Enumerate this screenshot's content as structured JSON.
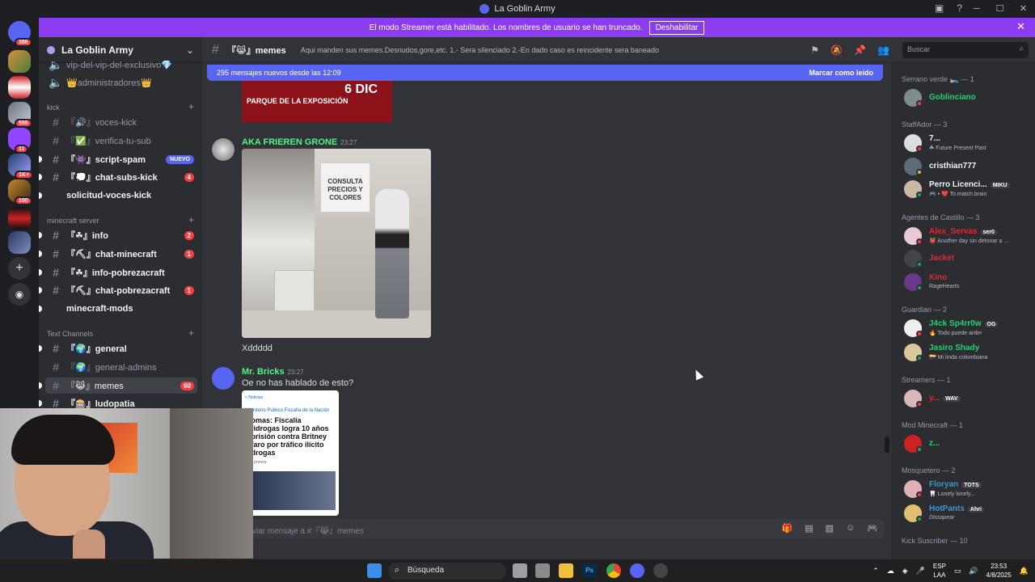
{
  "window": {
    "title": "La Goblin Army"
  },
  "banner": {
    "text": "El modo Streamer está habilitado. Los nombres de usuario se han truncado.",
    "button": "Deshabilitar"
  },
  "servers": [
    {
      "badge": "386"
    },
    {
      "badge": ""
    },
    {
      "badge": ""
    },
    {
      "badge": "555"
    },
    {
      "badge": "11"
    },
    {
      "badge": "1K+"
    },
    {
      "badge": "100"
    },
    {
      "badge": ""
    },
    {
      "badge": ""
    }
  ],
  "guild": {
    "name": "La Goblin Army"
  },
  "channels": {
    "top": [
      {
        "name": "vip-del-vip-del-exclusivo💎"
      },
      {
        "name": "👑administradores👑"
      }
    ],
    "cat_kick": "kick",
    "kick": [
      {
        "name": "『🔊』voces-kick"
      },
      {
        "name": "『✅』verifica-tu-sub"
      },
      {
        "name": "『👾』script-spam",
        "badge": "NUEVO"
      },
      {
        "name": "『💭』chat-subs-kick",
        "count": "4"
      },
      {
        "name": "solicitud-voces-kick"
      }
    ],
    "cat_minecraft": "minecraft server",
    "minecraft": [
      {
        "name": "『☘』info",
        "count": "2"
      },
      {
        "name": "『⛏』chat-minecraft",
        "count": "1"
      },
      {
        "name": "『☘』info-pobrezacraft"
      },
      {
        "name": "『⛏』chat-pobrezacraft",
        "count": "1"
      },
      {
        "name": "minecraft-mods"
      }
    ],
    "cat_text": "Text Channels",
    "text": [
      {
        "name": "『🌍』general"
      },
      {
        "name": "『🌍』general-admins"
      },
      {
        "name": "『😹』memes",
        "count": "60"
      },
      {
        "name": "『🎰』ludopatia"
      }
    ]
  },
  "header": {
    "channel": "『😹』memes",
    "topic": "Aqui manden sus memes.Desnudos,gore,etc. 1.- Sera silenciado 2.-En dado caso es reincidente sera baneado",
    "search_placeholder": "Buscar"
  },
  "new_messages": {
    "text": "295 mensajes nuevos desde las 12:09",
    "action": "Marcar como leído"
  },
  "messages": [
    {
      "image_text": "PARQUE DE LA EXPOSICIÓN",
      "image_big": "6 DIC"
    },
    {
      "author": "AKA FRIEREN GRONE",
      "time": "23:27",
      "image_sign": "CONSULTA PRECIOS Y COLORES",
      "text": "Xddddd"
    },
    {
      "author": "Mr. Bricks",
      "time": "23:27",
      "text": "Oe no has hablado de esto?",
      "news": {
        "src": "< Noticias",
        "org": "Ministerio Público Fiscalía de la Nación",
        "headline": "...omas: Fiscalía ...tidrogas logra 10 años ...prisión contra Britney ...faro por tráfico ilícito ...drogas",
        "note": "...de prensa"
      }
    }
  ],
  "composer": {
    "placeholder": "viar mensaje a #『😹』memes"
  },
  "members": {
    "groups": [
      {
        "title": "Serrano verde 🛌 — 1",
        "items": [
          {
            "name": "Goblinciano",
            "sub": "",
            "tag": "",
            "color": "#2ecc71"
          }
        ]
      },
      {
        "title": "StaffAdor — 3",
        "items": [
          {
            "name": "7...",
            "sub": "☘ Future Present Past",
            "tag": "",
            "color": "#f2f3f5"
          },
          {
            "name": "cristhian777",
            "sub": "",
            "tag": "",
            "color": "#f2f3f5"
          },
          {
            "name": "Perro Licenci...",
            "sub": "🎮 • ❤️ To match brain",
            "tag": "MIKU",
            "color": "#f2f3f5"
          }
        ]
      },
      {
        "title": "Agentes de Castillo — 3",
        "items": [
          {
            "name": "Alex_Servas",
            "sub": "👹 Another day sin detonar a ...",
            "tag": "ser0",
            "color": "#e4262e"
          },
          {
            "name": "Jacket",
            "sub": "",
            "tag": "",
            "color": "#e4262e"
          },
          {
            "name": "Kino",
            "sub": "RageHearts",
            "tag": "",
            "color": "#e4262e"
          }
        ]
      },
      {
        "title": "Guardian — 2",
        "items": [
          {
            "name": "J4ck Sp4rr0w",
            "sub": "🔥 Todo puede arder",
            "tag": "OG",
            "color": "#2ecc71"
          },
          {
            "name": "Jasiro Shady",
            "sub": "🇨🇴 Mi linda colombiana",
            "tag": "",
            "color": "#2ecc71"
          }
        ]
      },
      {
        "title": "Streamers — 1",
        "items": [
          {
            "name": "y...",
            "sub": "",
            "tag": "WAV",
            "color": "#e4262e"
          }
        ]
      },
      {
        "title": "Mod Minecraft — 1",
        "items": [
          {
            "name": "z...",
            "sub": "",
            "tag": "",
            "color": "#2ecc71"
          }
        ]
      },
      {
        "title": "Mosquetero — 2",
        "items": [
          {
            "name": "Floryan",
            "sub": "🦷 Lonely lonely...",
            "tag": "TOTS",
            "color": "#3498db"
          },
          {
            "name": "HotPants",
            "sub": "Dissapear",
            "tag": "Ahri",
            "color": "#3498db"
          }
        ]
      },
      {
        "title": "Kick Suscriber — 10",
        "items": []
      }
    ]
  },
  "taskbar": {
    "search": "Búsqueda",
    "lang1": "ESP",
    "lang2": "LAA",
    "time": "23:53",
    "date": "4/8/2025"
  },
  "colors": {
    "accent": "#5865f2",
    "streamer_banner": "#8c3cf0",
    "mention_red": "#f23f43",
    "online": "#23a55a"
  }
}
